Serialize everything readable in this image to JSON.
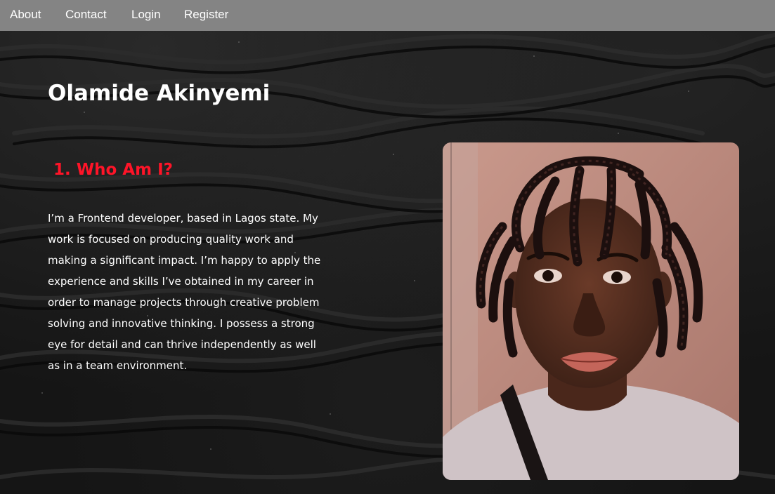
{
  "nav": {
    "items": [
      {
        "label": "About"
      },
      {
        "label": "Contact"
      },
      {
        "label": "Login"
      },
      {
        "label": "Register"
      }
    ]
  },
  "page": {
    "title": "Olamide Akinyemi"
  },
  "about": {
    "heading": "1. Who Am I?",
    "lines": [
      "I’m a Frontend developer, based in Lagos state. My",
      "work is focused on producing quality work and",
      "making a significant impact. I’m happy to apply the",
      "experience and skills I’ve obtained in my career in",
      "order to manage projects through creative problem",
      "solving and innovative thinking. I possess a strong",
      "eye for detail and can thrive independently as well",
      "as in a team environment."
    ]
  },
  "colors": {
    "navbar": "#848484",
    "background": "#151515",
    "heading_accent": "#ff1428",
    "text": "#ffffff"
  }
}
